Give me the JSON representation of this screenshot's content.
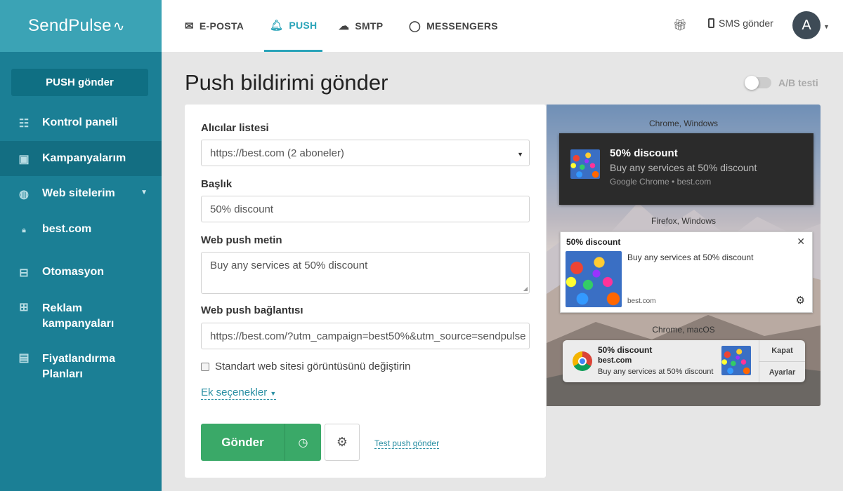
{
  "app": {
    "logo": "SendPulse",
    "logo_mark": "∿"
  },
  "sidebar": {
    "push_button": "PUSH gönder",
    "items": [
      {
        "label": "Kontrol paneli",
        "icon": "sliders-icon"
      },
      {
        "label": "Kampanyalarım",
        "icon": "inbox-icon"
      },
      {
        "label": "Web sitelerim",
        "icon": "globe-icon"
      },
      {
        "label": "best.com",
        "icon": "lock-icon"
      },
      {
        "label": "Otomasyon",
        "icon": "automation-icon"
      },
      {
        "label": "Reklam kampanyaları",
        "icon": "ads-icon"
      },
      {
        "label": "Fiyatlandırma Planları",
        "icon": "wallet-icon"
      }
    ]
  },
  "topbar": {
    "tabs": [
      {
        "label": "E-POSTA",
        "icon": "envelope-icon"
      },
      {
        "label": "PUSH",
        "icon": "bell-icon"
      },
      {
        "label": "SMTP",
        "icon": "cloud-upload-icon"
      },
      {
        "label": "MESSENGERS",
        "icon": "chat-icon"
      }
    ],
    "sms_label": "SMS gönder",
    "avatar_letter": "A"
  },
  "page": {
    "title": "Push bildirimi gönder",
    "ab_test_label": "A/B testi"
  },
  "form": {
    "recipients_label": "Alıcılar listesi",
    "recipients_value": "https://best.com (2 aboneler)",
    "title_label": "Başlık",
    "title_value": "50% discount",
    "text_label": "Web push metin",
    "text_value": "Buy any services at 50% discount",
    "link_label": "Web push bağlantısı",
    "link_value": "https://best.com/?utm_campaign=best50%&utm_source=sendpulse",
    "checkbox_label": "Standart web sitesi görüntüsünü değiştirin",
    "extra_options": "Ek seçenekler",
    "send_button": "Gönder",
    "test_link": "Test push gönder"
  },
  "preview": {
    "chrome_windows": {
      "label": "Chrome, Windows",
      "title": "50% discount",
      "body": "Buy any services at 50% discount",
      "source": "Google Chrome • best.com"
    },
    "firefox_windows": {
      "label": "Firefox, Windows",
      "title": "50% discount",
      "body": "Buy any services at 50% discount",
      "source": "best.com"
    },
    "chrome_macos": {
      "label": "Chrome, macOS",
      "title": "50% discount",
      "site": "best.com",
      "body": "Buy any services at 50% discount",
      "close": "Kapat",
      "settings": "Ayarlar"
    }
  },
  "colors": {
    "sidebar": "#1b7f95",
    "logo_bar": "#3ba3b5",
    "accent": "#2aa4b9",
    "send_green": "#3aa968"
  }
}
